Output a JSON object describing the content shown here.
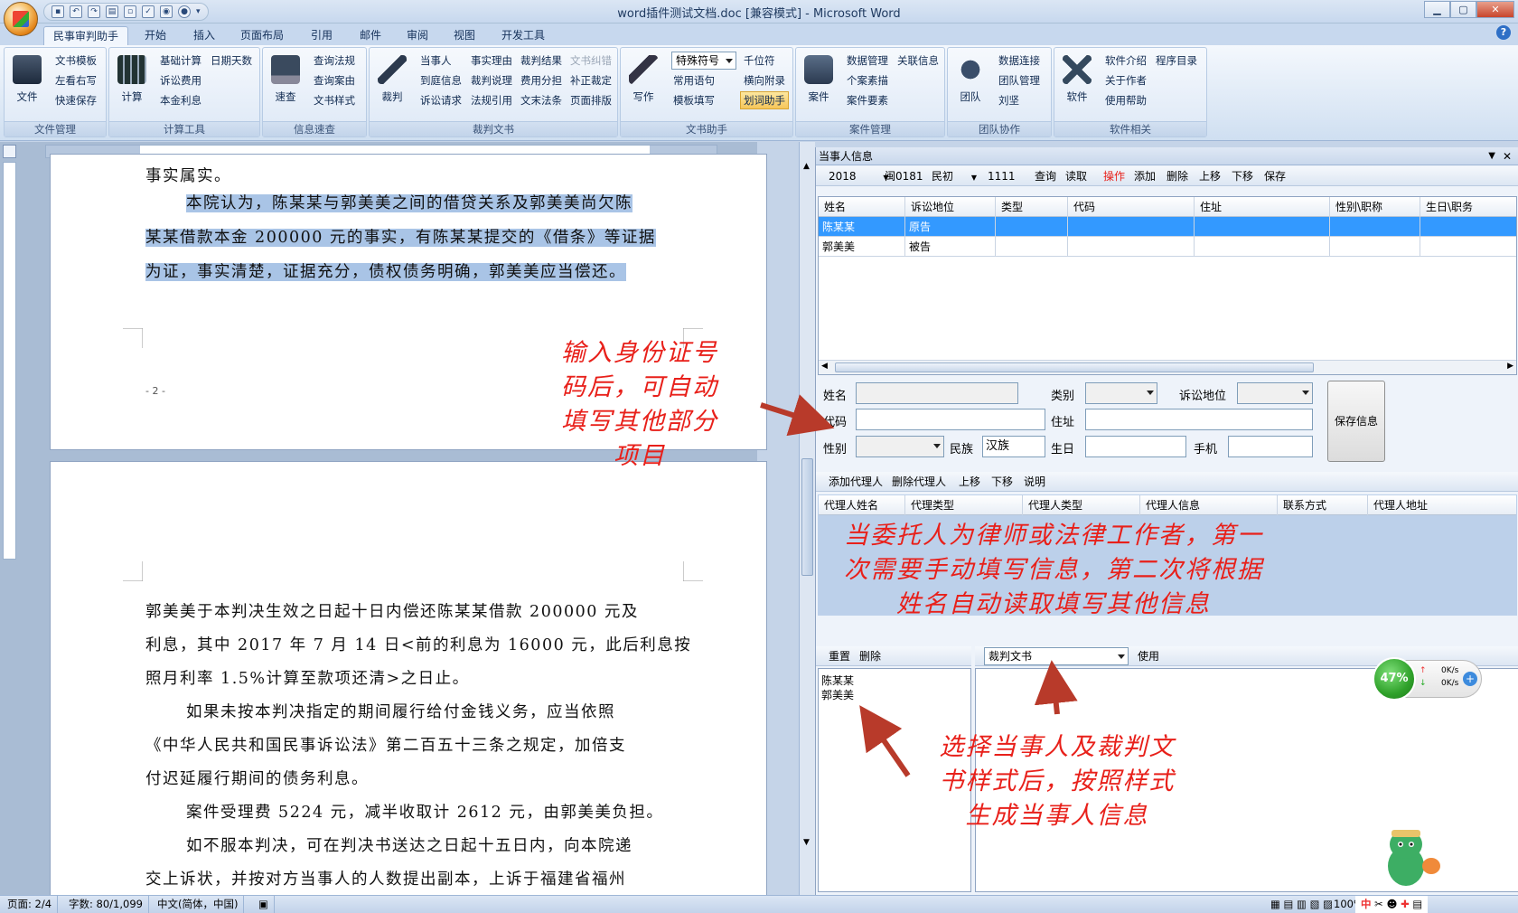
{
  "window": {
    "title": "word插件测试文档.doc [兼容模式] - Microsoft Word",
    "controls": [
      "▁",
      "▢",
      "✕"
    ]
  },
  "tabs": [
    "民事审判助手",
    "开始",
    "插入",
    "页面布局",
    "引用",
    "邮件",
    "审阅",
    "视图",
    "开发工具"
  ],
  "ribbon": {
    "groups": [
      {
        "label": "文件管理",
        "big": "文件",
        "small": [
          "文书模板",
          "左看右写",
          "快速保存"
        ]
      },
      {
        "label": "计算工具",
        "big": "计算",
        "small": [
          "基础计算",
          "日期天数",
          "诉讼费用",
          "本金利息"
        ]
      },
      {
        "label": "信息速查",
        "big": "速查",
        "small": [
          "查询法规",
          "查询案由",
          "文书样式"
        ]
      },
      {
        "label": "裁判文书",
        "big": "裁判",
        "small": [
          "当事人",
          "事实理由",
          "裁判结果",
          "文书纠错",
          "到庭信息",
          "裁判说理",
          "费用分担",
          "补正裁定",
          "诉讼请求",
          "法规引用",
          "文末法条",
          "页面排版"
        ]
      },
      {
        "label": "文书助手",
        "big": "写作",
        "combo": "特殊符号",
        "small": [
          "千位符",
          "常用语句",
          "横向附录",
          "模板填写",
          "划词助手"
        ]
      },
      {
        "label": "案件管理",
        "big": "案件",
        "small": [
          "数据管理",
          "关联信息",
          "个案素描",
          "案件要素"
        ]
      },
      {
        "label": "团队协作",
        "big": "团队",
        "small": [
          "数据连接",
          "团队管理",
          "刘坚"
        ]
      },
      {
        "label": "软件相关",
        "big": "软件",
        "small": [
          "软件介绍",
          "程序目录",
          "关于作者",
          "使用帮助"
        ]
      }
    ]
  },
  "document": {
    "page1_lines": [
      "事实属实。",
      "本院认为，陈某某与郭美美之间的借贷关系及郭美美尚欠陈",
      "某某借款本金 200000 元的事实，有陈某某提交的《借条》等证据",
      "为证，事实清楚，证据充分，债权债务明确，郭美美应当偿还。"
    ],
    "page_number": "- 2 -",
    "page2_lines": [
      "郭美美于本判决生效之日起十日内偿还陈某某借款 200000 元及",
      "利息，其中 2017 年 7 月 14 日<前的利息为 16000 元，此后利息按",
      "照月利率 1.5%计算至款项还清>之日止。",
      "如果未按本判决指定的期间履行给付金钱义务，应当依照",
      "《中华人民共和国民事诉讼法》第二百五十三条之规定，加倍支",
      "付迟延履行期间的债务利息。",
      "案件受理费 5224 元，减半收取计 2612 元，由郭美美负担。",
      "如不服本判决，可在判决书送达之日起十五日内，向本院递",
      "交上诉状，并按对方当事人的人数提出副本，上诉于福建省福州"
    ]
  },
  "pane": {
    "title": "当事人信息",
    "toolbar": {
      "year": "2018",
      "court": "闽0181",
      "casetype": "民初",
      "number": "1111",
      "buttons": [
        "查询",
        "读取",
        "操作",
        "添加",
        "删除",
        "上移",
        "下移",
        "保存"
      ]
    },
    "party_columns": [
      "姓名",
      "诉讼地位",
      "类型",
      "代码",
      "住址",
      "性别\\职称",
      "生日\\职务"
    ],
    "party_rows": [
      {
        "name": "陈某某",
        "role": "原告"
      },
      {
        "name": "郭美美",
        "role": "被告"
      }
    ],
    "form": {
      "name_label": "姓名",
      "type_label": "类别",
      "role_label": "诉讼地位",
      "code_label": "代码",
      "address_label": "住址",
      "gender_label": "性别",
      "ethnic_label": "民族",
      "ethnic_value": "汉族",
      "birthday_label": "生日",
      "phone_label": "手机",
      "save_label": "保存信息"
    },
    "agent_toolbar": [
      "添加代理人",
      "删除代理人",
      "上移",
      "下移",
      "说明"
    ],
    "agent_columns": [
      "代理人姓名",
      "代理类型",
      "代理人类型",
      "代理人信息",
      "联系方式",
      "代理人地址"
    ],
    "bottom_left_toolbar": [
      "重置",
      "删除"
    ],
    "bottom_left_list": [
      "陈某某",
      "郭美美"
    ],
    "doc_style_combo": "裁判文书",
    "use_label": "使用"
  },
  "annotations": {
    "a1": [
      "输入身份证号",
      "码后，可自动",
      "填写其他部分",
      "项目"
    ],
    "a2": [
      "当委托人为律师或法律工作者，第一",
      "次需要手动填写信息，第二次将根据",
      "姓名自动读取填写其他信息"
    ],
    "a3": [
      "选择当事人及裁判文",
      "书样式后，按照样式",
      "生成当事人信息"
    ]
  },
  "widget": {
    "percent": "47%",
    "up": "0K/s",
    "down": "0K/s"
  },
  "statusbar": {
    "page": "页面: 2/4",
    "words": "字数: 80/1,099",
    "lang": "中文(简体，中国)",
    "zoom": "100%"
  },
  "colors": {
    "annotation": "#e8201a",
    "selection": "#3399ff"
  }
}
